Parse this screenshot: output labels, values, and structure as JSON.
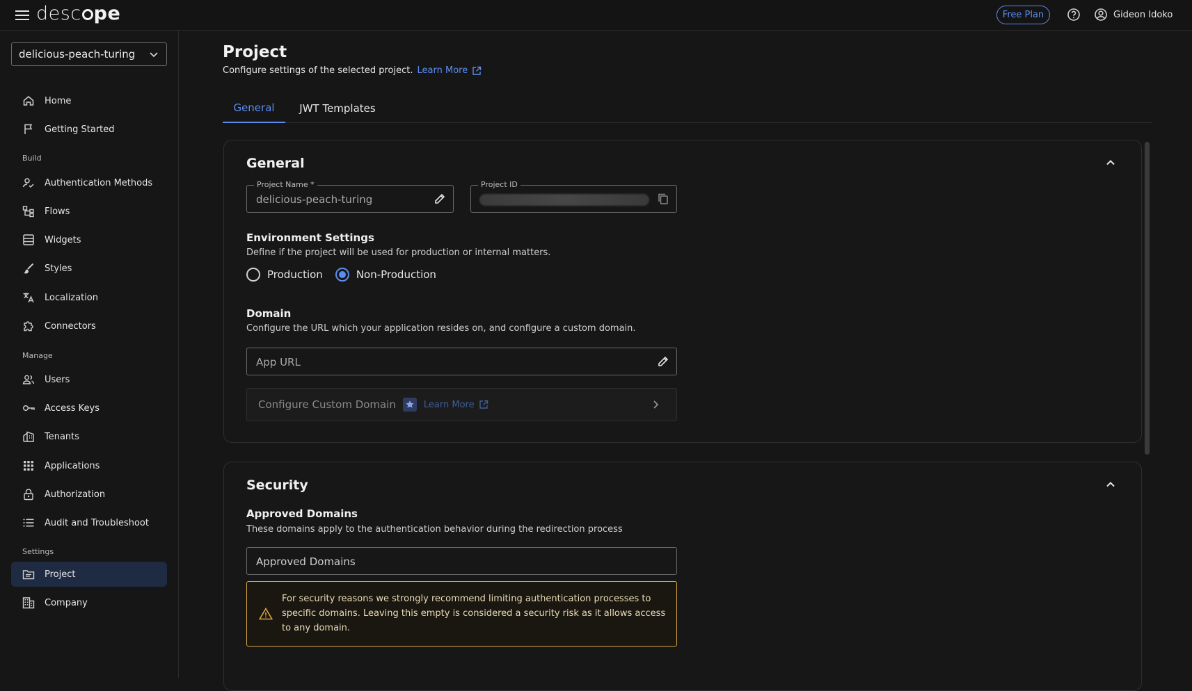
{
  "topbar": {
    "logo_text_light": "desc",
    "logo_text_bold": "pe",
    "plan_label": "Free Plan",
    "user_name": "Gideon Idoko"
  },
  "sidebar": {
    "project_selector": "delicious-peach-turing",
    "items_top": [
      {
        "label": "Home",
        "icon": "home-icon"
      },
      {
        "label": "Getting Started",
        "icon": "flag-icon"
      }
    ],
    "section_build": "Build",
    "items_build": [
      {
        "label": "Authentication Methods",
        "icon": "person-check-icon"
      },
      {
        "label": "Flows",
        "icon": "flow-icon"
      },
      {
        "label": "Widgets",
        "icon": "widgets-icon"
      },
      {
        "label": "Styles",
        "icon": "brush-icon"
      },
      {
        "label": "Localization",
        "icon": "translate-icon"
      },
      {
        "label": "Connectors",
        "icon": "puzzle-icon"
      }
    ],
    "section_manage": "Manage",
    "items_manage": [
      {
        "label": "Users",
        "icon": "users-icon"
      },
      {
        "label": "Access Keys",
        "icon": "key-icon"
      },
      {
        "label": "Tenants",
        "icon": "building-icon"
      },
      {
        "label": "Applications",
        "icon": "apps-grid-icon"
      },
      {
        "label": "Authorization",
        "icon": "lock-icon"
      },
      {
        "label": "Audit and Troubleshoot",
        "icon": "list-icon"
      }
    ],
    "section_settings": "Settings",
    "items_settings": [
      {
        "label": "Project",
        "icon": "folder-icon",
        "active": true
      },
      {
        "label": "Company",
        "icon": "company-icon"
      }
    ]
  },
  "main": {
    "title": "Project",
    "subtitle": "Configure settings of the selected project.",
    "learn_more": "Learn More",
    "tabs": [
      {
        "label": "General",
        "active": true
      },
      {
        "label": "JWT Templates",
        "active": false
      }
    ],
    "general_card": {
      "title": "General",
      "project_name_label": "Project Name *",
      "project_name_value": "delicious-peach-turing",
      "project_id_label": "Project ID",
      "env_heading": "Environment Settings",
      "env_desc": "Define if the project will be used for production or internal matters.",
      "env_options": [
        {
          "label": "Production",
          "selected": false
        },
        {
          "label": "Non-Production",
          "selected": true
        }
      ],
      "domain_heading": "Domain",
      "domain_desc": "Configure the URL which your application resides on, and configure a custom domain.",
      "app_url_placeholder": "App URL",
      "custom_domain_label": "Configure Custom Domain",
      "custom_domain_link": "Learn More"
    },
    "security_card": {
      "title": "Security",
      "approved_heading": "Approved Domains",
      "approved_desc": "These domains apply to the authentication behavior during the redirection process",
      "approved_placeholder": "Approved Domains",
      "warning_text": "For security reasons we strongly recommend limiting authentication processes to specific domains. Leaving this empty is considered a security risk as it allows access to any domain."
    }
  },
  "colors": {
    "accent": "#5b8def",
    "warning": "#d9a441",
    "background": "#161616"
  }
}
